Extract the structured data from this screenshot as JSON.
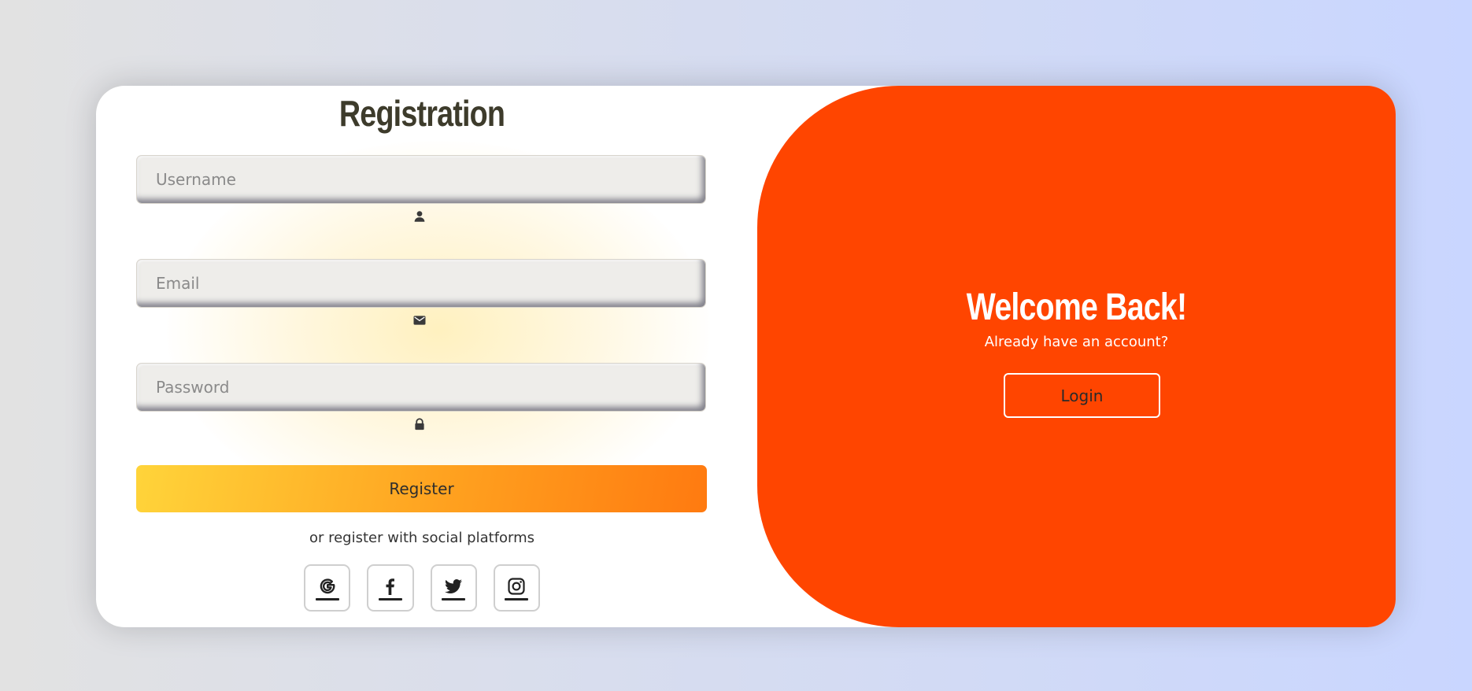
{
  "registration": {
    "title": "Registration",
    "username_placeholder": "Username",
    "email_placeholder": "Email",
    "password_placeholder": "Password",
    "register_label": "Register",
    "social_text": "or register with social platforms",
    "social_icons": [
      "google-icon",
      "facebook-icon",
      "twitter-icon",
      "instagram-icon"
    ]
  },
  "welcome": {
    "title": "Welcome Back!",
    "subtitle": "Already have an account?",
    "login_label": "Login"
  },
  "colors": {
    "panel": "#ff4500",
    "register_gradient_start": "#ffd43a",
    "register_gradient_end": "#ff7a10",
    "title_text": "#3d3b2b"
  }
}
